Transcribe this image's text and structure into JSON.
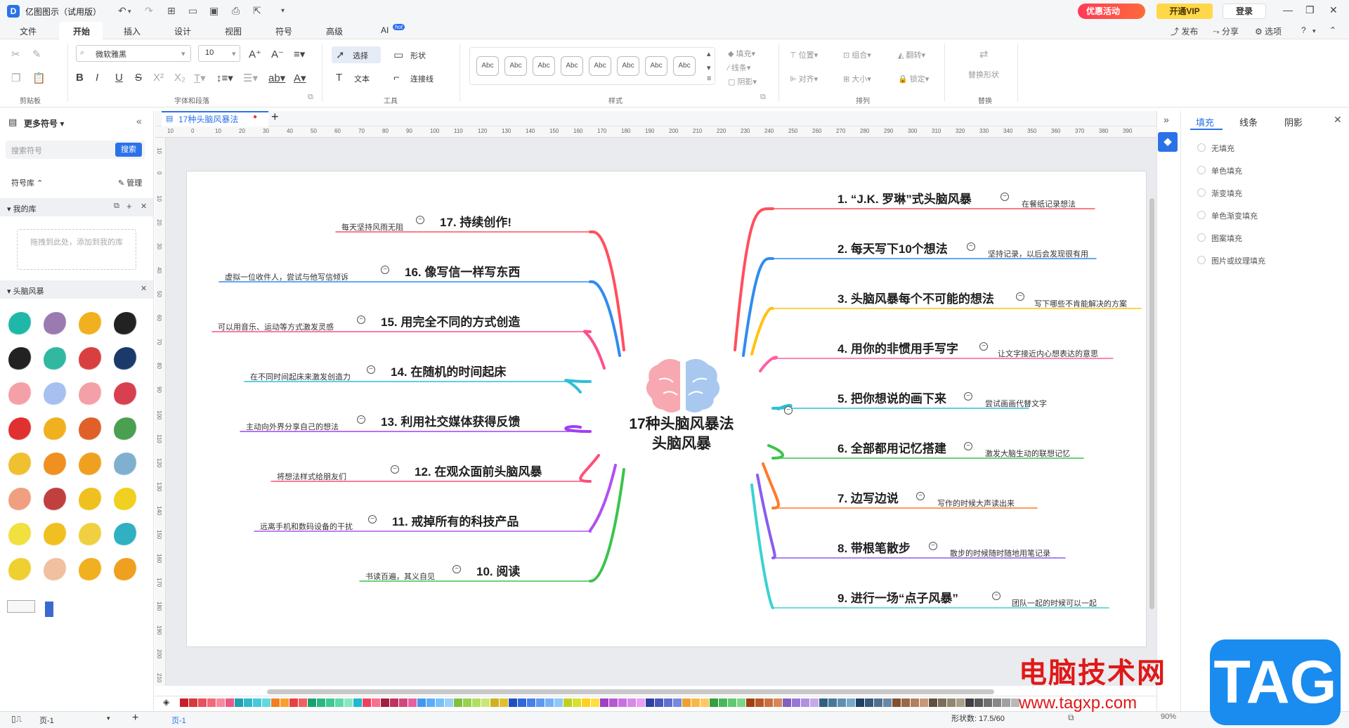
{
  "titlebar": {
    "app_title": "亿图图示（试用版）",
    "promo": "优惠活动",
    "vip": "开通VIP",
    "login": "登录"
  },
  "menu": {
    "tabs": [
      "文件",
      "开始",
      "插入",
      "设计",
      "视图",
      "符号",
      "高级",
      "AI"
    ],
    "hot_badge": "hot",
    "right": [
      "发布",
      "分享",
      "选项"
    ]
  },
  "ribbon": {
    "groups": [
      "剪贴板",
      "字体和段落",
      "工具",
      "样式",
      "排列",
      "替换"
    ],
    "font_name": "微软雅黑",
    "font_size": "10",
    "tools": [
      "选择",
      "形状",
      "文本",
      "连接线"
    ],
    "style_samples": [
      "Abc",
      "Abc",
      "Abc",
      "Abc",
      "Abc",
      "Abc",
      "Abc",
      "Abc"
    ],
    "fill_group": [
      "填充",
      "线条",
      "阴影"
    ],
    "arrange": [
      "位置",
      "组合",
      "翻转",
      "对齐",
      "大小",
      "锁定"
    ],
    "replace": "替换形状"
  },
  "left_panel": {
    "title": "更多符号",
    "search_placeholder": "搜索符号",
    "search_btn": "搜索",
    "library_label": "符号库",
    "manage": "管理",
    "my_library": "我的库",
    "drop_hint": "拖拽到此处，添加到我的库",
    "brainstorm_library": "头脑风暴"
  },
  "document": {
    "tab_title": "17种头脑风暴法"
  },
  "ruler": {
    "h": [
      "10",
      "0",
      "10",
      "20",
      "30",
      "40",
      "50",
      "60",
      "70",
      "80",
      "90",
      "100",
      "110",
      "120",
      "130",
      "140",
      "150",
      "160",
      "170",
      "180",
      "190",
      "200",
      "210",
      "220",
      "230",
      "240",
      "250",
      "260",
      "270",
      "280",
      "290",
      "300",
      "310",
      "320",
      "330",
      "340",
      "350",
      "360",
      "370",
      "380",
      "390"
    ],
    "v": [
      "10",
      "0",
      "10",
      "20",
      "30",
      "40",
      "50",
      "60",
      "70",
      "80",
      "90",
      "100",
      "110",
      "120",
      "130",
      "140",
      "150",
      "160",
      "170",
      "180",
      "190",
      "200",
      "210"
    ]
  },
  "mindmap": {
    "center": "17种头脑风暴法头脑风暴",
    "right_nodes": [
      {
        "title": "1. “J.K. 罗琳”式头脑风暴",
        "desc": "在餐纸记录想法",
        "color": "#ff4f5e"
      },
      {
        "title": "2. 每天写下10个想法",
        "desc": "坚持记录，以后会发现很有用",
        "color": "#2f8cf0"
      },
      {
        "title": "3. 头脑风暴每个不可能的想法",
        "desc": "写下哪些不肯能解决的方案",
        "color": "#ffc20e"
      },
      {
        "title": "4. 用你的非惯用手写字",
        "desc": "让文字接近内心想表达的意思",
        "color": "#ff5fa0"
      },
      {
        "title": "5. 把你想说的画下来",
        "desc": "尝试画画代替文字",
        "color": "#2fbfd8"
      },
      {
        "title": "6. 全部都用记忆搭建",
        "desc": "激发大脑生动的联想记忆",
        "color": "#3cc44c"
      },
      {
        "title": "7. 边写边说",
        "desc": "写作的时候大声读出来",
        "color": "#ff7a2a"
      },
      {
        "title": "8. 带根笔散步",
        "desc": "散步的时候随时随地用笔记录",
        "color": "#8a5cf0"
      },
      {
        "title": "9. 进行一场“点子风暴”",
        "desc": "团队一起的时候可以一起",
        "color": "#3cd2d2"
      }
    ],
    "left_nodes": [
      {
        "title": "17. 持续创作!",
        "desc": "每天坚持风雨无阻",
        "color": "#ff4f5e"
      },
      {
        "title": "16. 像写信一样写东西",
        "desc": "虚拟一位收件人，尝试与他写信倾诉",
        "color": "#2f8cf0"
      },
      {
        "title": "15. 用完全不同的方式创造",
        "desc": "可以用音乐、运动等方式激发灵感",
        "color": "#ff4f8a"
      },
      {
        "title": "14. 在随机的时间起床",
        "desc": "在不同时间起床来激发创造力",
        "color": "#2fbfd8"
      },
      {
        "title": "13. 利用社交媒体获得反馈",
        "desc": "主动向外界分享自己的想法",
        "color": "#a040f0"
      },
      {
        "title": "12. 在观众面前头脑风暴",
        "desc": "将想法样式给朋友们",
        "color": "#ff4f7a"
      },
      {
        "title": "11. 戒掉所有的科技产品",
        "desc": "远离手机和数码设备的干扰",
        "color": "#b050f0"
      },
      {
        "title": "10. 阅读",
        "desc": "书读百遍，其义自见",
        "color": "#3cc44c"
      }
    ]
  },
  "right_panel": {
    "tabs": [
      "填充",
      "线条",
      "阴影"
    ],
    "options": [
      "无填充",
      "单色填充",
      "渐变填充",
      "单色渐变填充",
      "图案填充",
      "图片或纹理填充"
    ]
  },
  "statusbar": {
    "page_label": "页-1",
    "page_tab": "页-1",
    "shape_count": "形状数: 17.5/60",
    "zoom": "90%"
  },
  "palette": [
    "#c8202a",
    "#d83a3a",
    "#e85060",
    "#f06a7a",
    "#f58aa0",
    "#e85a8a",
    "#20a0b0",
    "#30b8c8",
    "#48c8d8",
    "#60d8e0",
    "#f08020",
    "#f8a030",
    "#e84040",
    "#f06060",
    "#1aa070",
    "#2ab880",
    "#40c890",
    "#60d8a8",
    "#8ae8c0",
    "#20b8d0",
    "#f04060",
    "#f87090",
    "#a02040",
    "#c03060",
    "#d04878",
    "#e860a0",
    "#4098f0",
    "#5aaef8",
    "#78c0f8",
    "#98d0f8",
    "#80c040",
    "#98d050",
    "#b0e060",
    "#c8e878",
    "#d0b020",
    "#e0c030",
    "#2050c0",
    "#3068d8",
    "#4880e8",
    "#6098f0",
    "#78b0f8",
    "#90c8f8",
    "#c0d020",
    "#d8e030",
    "#ffd020",
    "#ffe040",
    "#a040c0",
    "#b858d0",
    "#c870e0",
    "#d888e8",
    "#e8a0f0",
    "#3040a0",
    "#4858b8",
    "#6070d0",
    "#7888e0",
    "#f0a030",
    "#f8b848",
    "#ffc860",
    "#30a040",
    "#48b858",
    "#60c870",
    "#78d888",
    "#a04010",
    "#b85828",
    "#c87040",
    "#d88858",
    "#8060c0",
    "#9878d0",
    "#b090e0",
    "#c8a8e8",
    "#306080",
    "#487898",
    "#6090b0",
    "#78a8c8",
    "#204060",
    "#385878",
    "#507090",
    "#6888a8",
    "#805030",
    "#986848",
    "#b08060",
    "#c89878",
    "#605040",
    "#787058",
    "#908870",
    "#a8a088",
    "#404040",
    "#585858",
    "#707070",
    "#888888",
    "#a0a0a0",
    "#b8b8b8",
    "#d0d0d0",
    "#e8e8e8",
    "#8a1010",
    "#a02828",
    "#b84040",
    "#c85858",
    "#d87070"
  ],
  "watermark": {
    "cn": "电脑技术网",
    "url": "www.tagxp.com",
    "tag": "TAG"
  }
}
